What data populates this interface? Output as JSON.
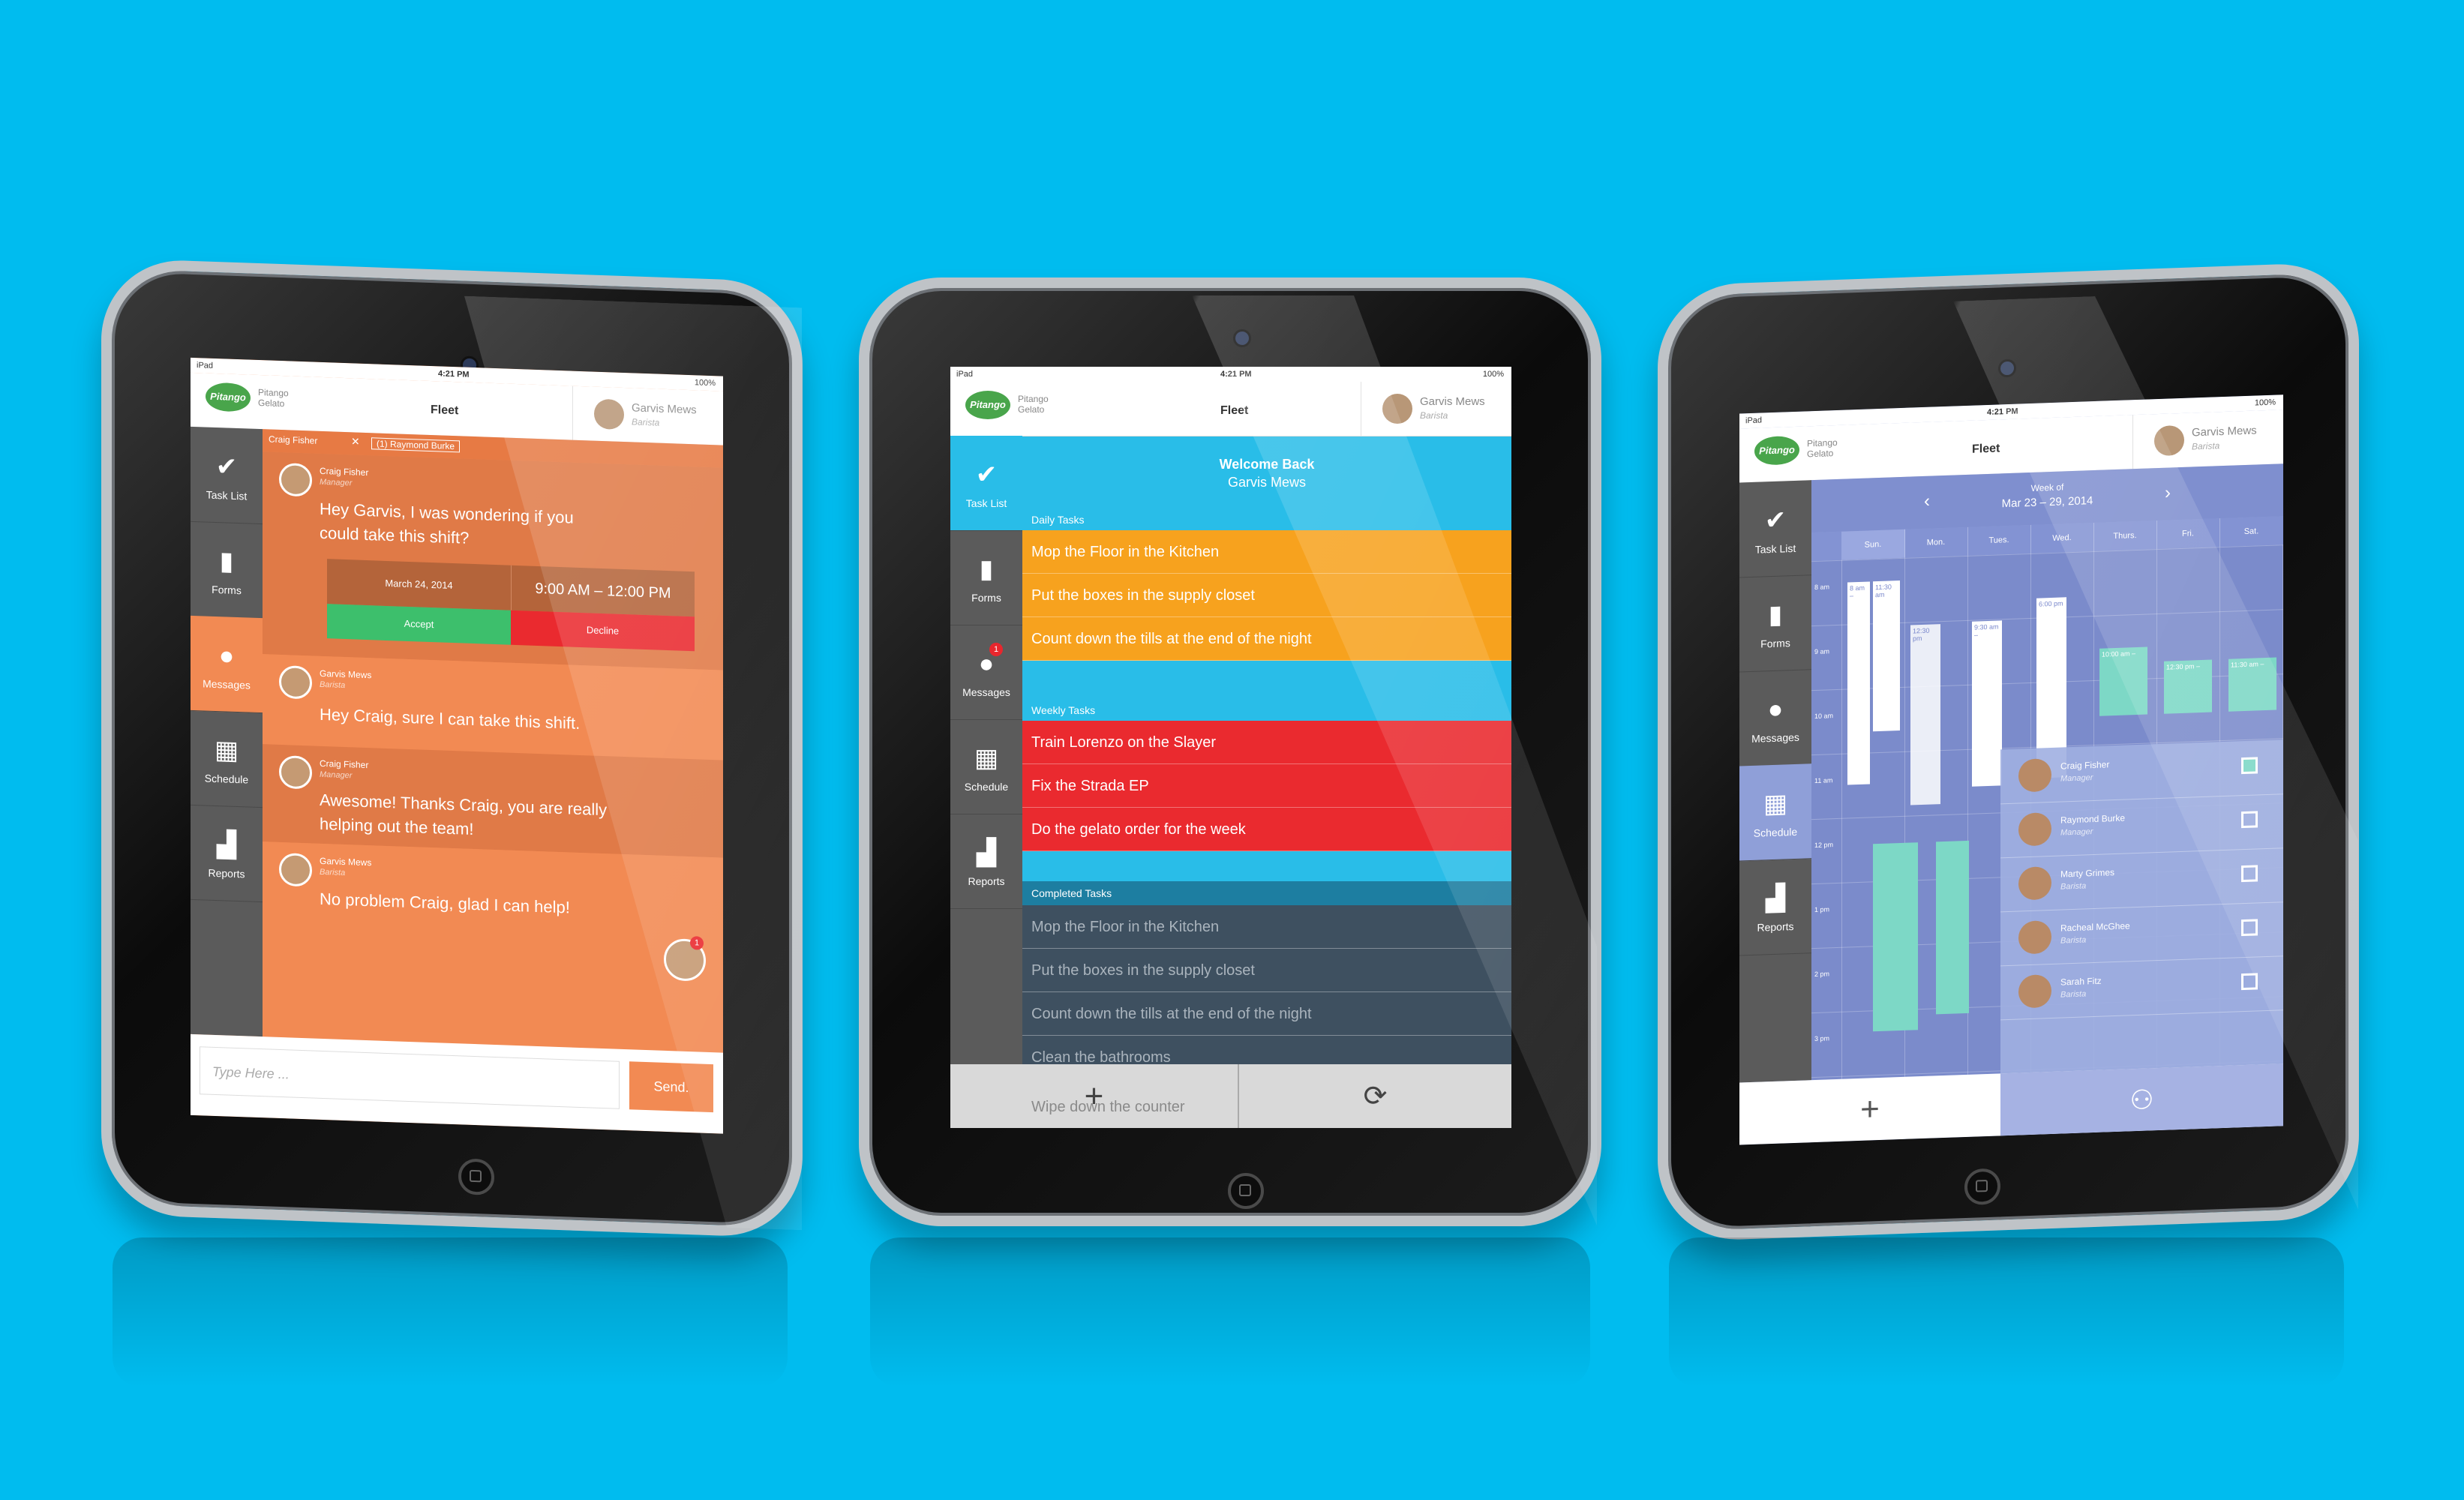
{
  "status": {
    "device": "iPad",
    "time": "4:21 PM",
    "battery": "100%"
  },
  "app": {
    "brand_logo": "Pitango",
    "brand_name": "Pitango",
    "brand_sub": "Gelato",
    "title": "Fleet",
    "user_name": "Garvis Mews",
    "user_role": "Barista"
  },
  "nav": [
    {
      "label": "Task List",
      "icon": "checkmark-icon",
      "glyph": "✔"
    },
    {
      "label": "Forms",
      "icon": "book-icon",
      "glyph": "▮"
    },
    {
      "label": "Messages",
      "icon": "speech-bubble-icon",
      "glyph": "●",
      "badge": "1"
    },
    {
      "label": "Schedule",
      "icon": "calendar-icon",
      "glyph": "▦"
    },
    {
      "label": "Reports",
      "icon": "bar-chart-icon",
      "glyph": "▟"
    }
  ],
  "messages": {
    "recipients_label": "Craig Fisher",
    "recipient_chip": "(1) Raymond Burke",
    "thread": [
      {
        "name": "Craig Fisher",
        "role": "Manager",
        "text": "Hey Garvis, I was wondering if you could take this shift?"
      },
      {
        "name": "Garvis Mews",
        "role": "Barista",
        "text": "Hey Craig, sure I can take this shift."
      },
      {
        "name": "Craig Fisher",
        "role": "Manager",
        "text": "Awesome! Thanks Craig, you are really helping out the team!"
      },
      {
        "name": "Garvis Mews",
        "role": "Barista",
        "text": "No problem Craig, glad I can help!"
      }
    ],
    "shift_request": {
      "date": "March 24, 2014",
      "time": "9:00 AM – 12:00 PM",
      "accept": "Accept",
      "decline": "Decline"
    },
    "floating_badge": "1",
    "input_placeholder": "Type Here ...",
    "send_label": "Send."
  },
  "tasklist": {
    "welcome": "Welcome Back",
    "welcome_name": "Garvis Mews",
    "daily_label": "Daily Tasks",
    "daily": [
      "Mop the Floor in the Kitchen",
      "Put the boxes in the supply closet",
      "Count down the tills at the end of the night"
    ],
    "weekly_label": "Weekly Tasks",
    "weekly": [
      "Train Lorenzo on the Slayer",
      "Fix the Strada EP",
      "Do the gelato order for the week"
    ],
    "completed_label": "Completed Tasks",
    "completed": [
      "Mop the Floor in the Kitchen",
      "Put the boxes in the supply closet",
      "Count down the tills at the end of the night",
      "Clean the bathrooms",
      "Wipe down the counter"
    ],
    "add_label": "+",
    "refresh_label": "⟳"
  },
  "schedule": {
    "week_of": "Week of",
    "range": "Mar 23 – 29, 2014",
    "days": [
      "Sun.",
      "Mon.",
      "Tues.",
      "Wed.",
      "Thurs.",
      "Fri.",
      "Sat."
    ],
    "hours": [
      "8 am",
      "9 am",
      "10 am",
      "11 am",
      "12 pm",
      "1 pm",
      "2 pm",
      "3 pm"
    ],
    "shift_labels": [
      "8 am –",
      "11:30 am",
      "12:30 pm",
      "9:30 am –",
      "6:00 pm",
      "10:00 am –",
      "12:30 pm –",
      "11:30 am –"
    ],
    "staff": [
      {
        "name": "Craig Fisher",
        "role": "Manager",
        "checked": true
      },
      {
        "name": "Raymond Burke",
        "role": "Manager",
        "checked": false
      },
      {
        "name": "Marty Grimes",
        "role": "Barista",
        "checked": false
      },
      {
        "name": "Racheal McGhee",
        "role": "Barista",
        "checked": false
      },
      {
        "name": "Sarah Fitz",
        "role": "Barista",
        "checked": false
      }
    ],
    "add_label": "+",
    "people_label": "⚇"
  },
  "colors": {
    "background": "#00bcef",
    "orange": "#f28a53",
    "gold": "#f7a21e",
    "red": "#ea2a2f",
    "slate": "#3e5060",
    "periwinkle": "#8f9fd8",
    "teal": "#7dd8c6",
    "green": "#3dbf6c"
  }
}
